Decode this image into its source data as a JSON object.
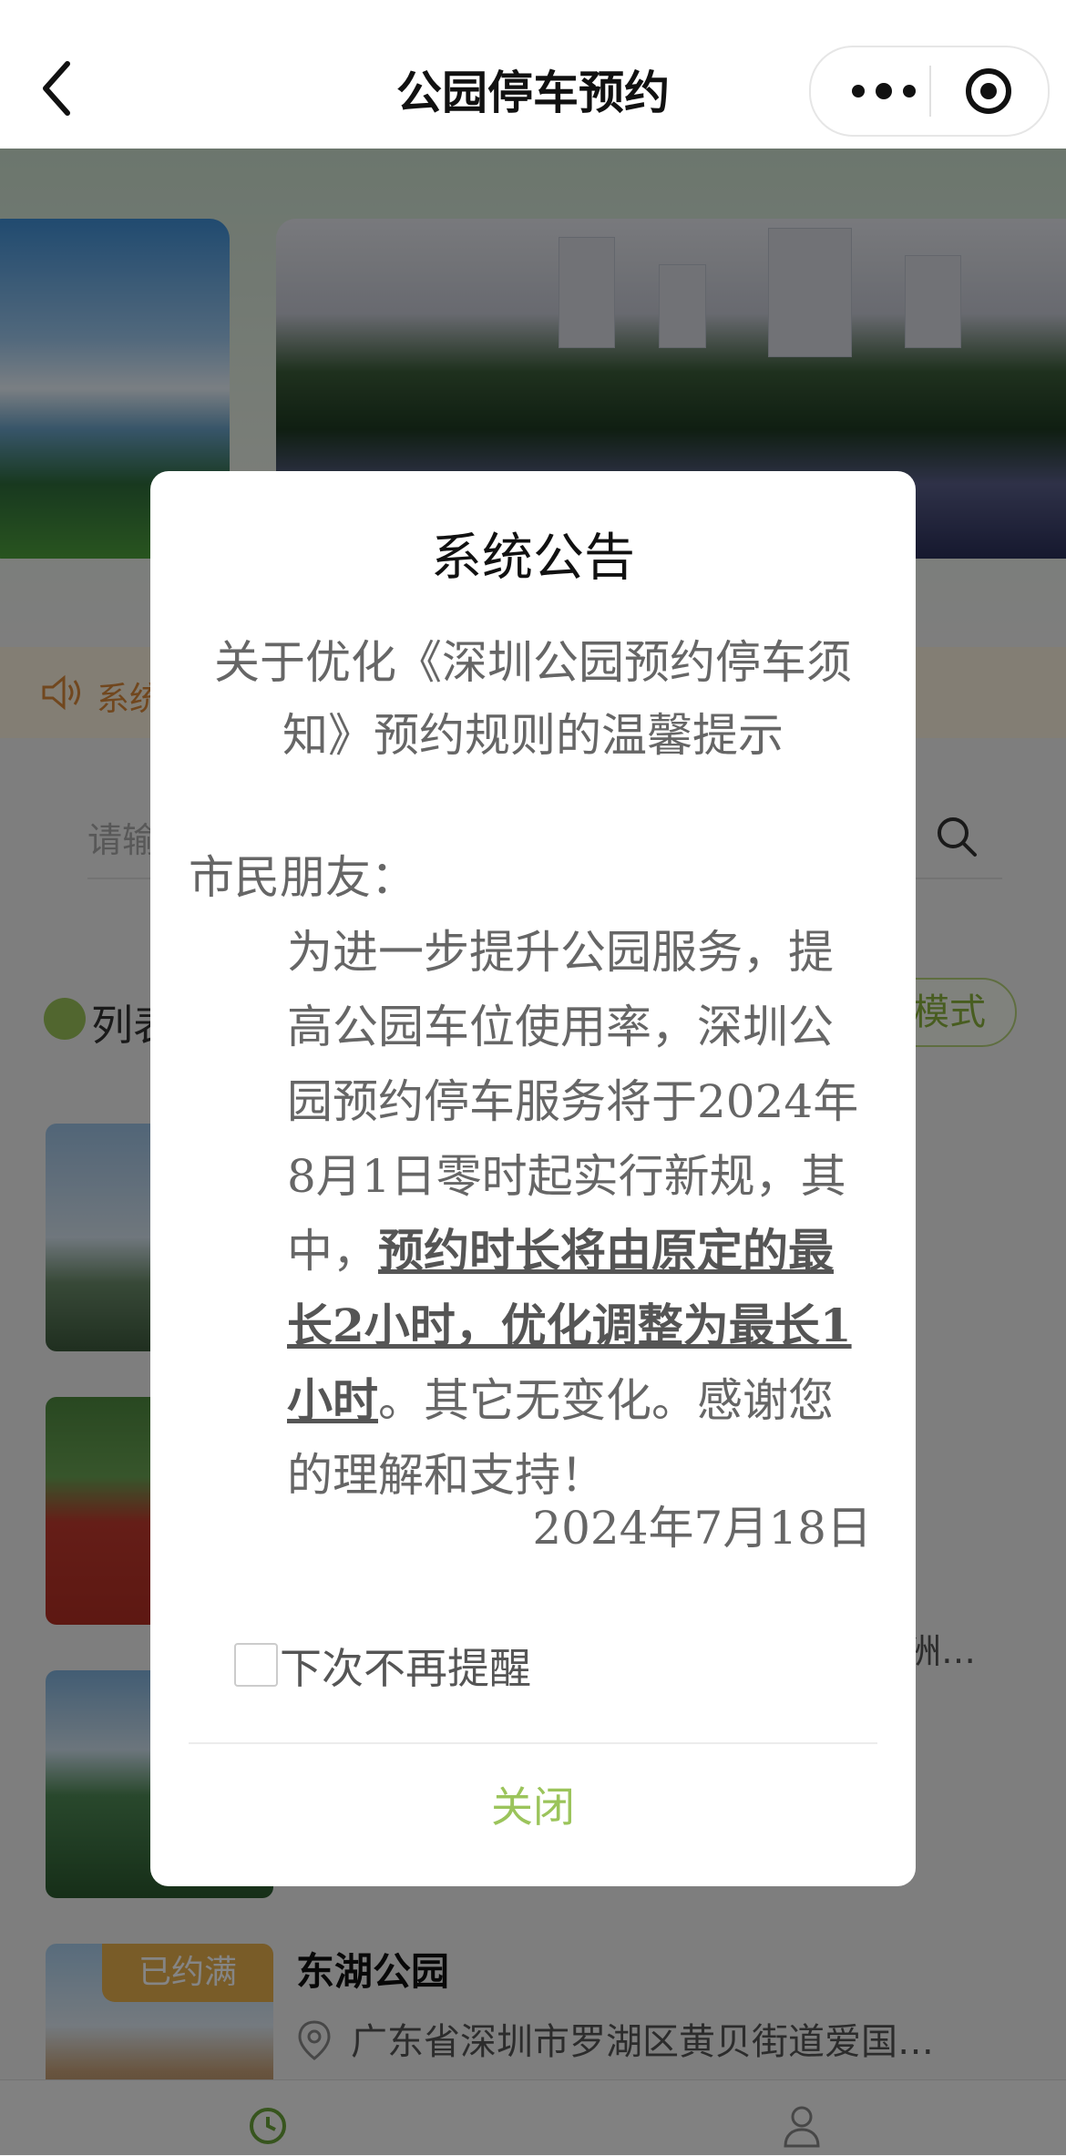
{
  "header": {
    "title": "公园停车预约"
  },
  "notice_bar": {
    "text": "系统"
  },
  "search": {
    "placeholder": "请输"
  },
  "list": {
    "label": "列表",
    "mode_button": "模式"
  },
  "parks": [
    {
      "address_tail": "洲…"
    },
    {
      "name": "东湖公园",
      "address": "广东省深圳市罗湖区黄贝街道爱国…",
      "status": "已约满"
    }
  ],
  "modal": {
    "title": "系统公告",
    "subtitle": "关于优化《深圳公园预约停车须知》预约规则的温馨提示",
    "greeting": "市民朋友：",
    "body_part1": "为进一步提升公园服务，提高公园车位使用率，深圳公园预约停车服务将于2024年8月1日零时起实行新规，其中，",
    "body_emphasis": "预约时长将由原定的最长2小时，优化调整为最长1小时",
    "body_part2": "。其它无变化。感谢您的理解和支持！",
    "date": "2024年7月18日",
    "checkbox_label": "下次不再提醒",
    "close_label": "关闭"
  },
  "colors": {
    "accent": "#9bc45b",
    "notice": "#d9883a",
    "badge": "#e8b04e"
  }
}
